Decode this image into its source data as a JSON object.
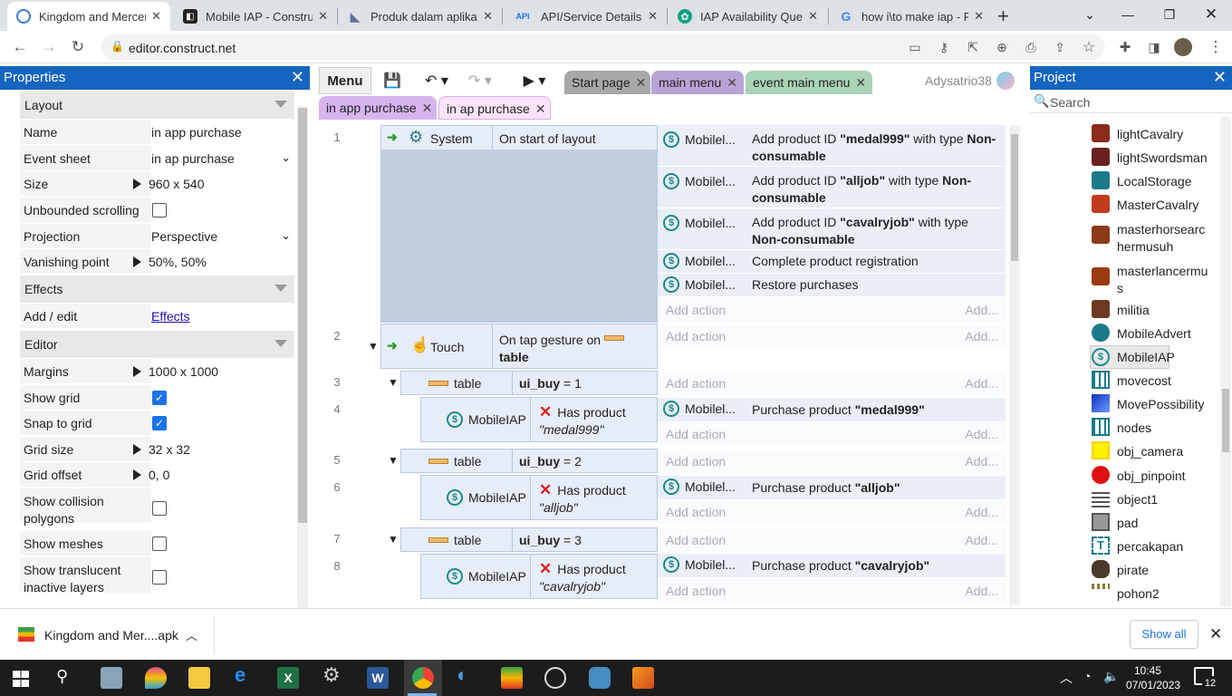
{
  "browser": {
    "tabs": [
      {
        "label": "Kingdom and Mercen",
        "active": true
      },
      {
        "label": "Mobile IAP - Construc"
      },
      {
        "label": "Produk dalam aplikasi"
      },
      {
        "label": "API/Service Details – A"
      },
      {
        "label": "IAP Availability Query"
      },
      {
        "label": "how i\\to make iap - Pe"
      }
    ],
    "new_tab": "+",
    "url": "editor.construct.net"
  },
  "properties": {
    "title": "Properties",
    "sections": {
      "layout": "Layout",
      "effects": "Effects",
      "editor": "Editor"
    },
    "rows": {
      "name": {
        "label": "Name",
        "value": "in app purchase"
      },
      "event_sheet": {
        "label": "Event sheet",
        "value": "in ap purchase"
      },
      "size": {
        "label": "Size",
        "value": "960 x 540"
      },
      "unbounded": {
        "label": "Unbounded scrolling"
      },
      "projection": {
        "label": "Projection",
        "value": "Perspective"
      },
      "vanishing": {
        "label": "Vanishing point",
        "value": "50%, 50%"
      },
      "add_edit": {
        "label": "Add / edit",
        "value": "Effects"
      },
      "margins": {
        "label": "Margins",
        "value": "1000 x 1000"
      },
      "show_grid": {
        "label": "Show grid"
      },
      "snap_grid": {
        "label": "Snap to grid"
      },
      "grid_size": {
        "label": "Grid size",
        "value": "32 x 32"
      },
      "grid_offset": {
        "label": "Grid offset",
        "value": "0, 0"
      },
      "collision_1": {
        "label": "Show collision"
      },
      "collision_2": {
        "label": "polygons"
      },
      "meshes": {
        "label": "Show meshes"
      },
      "translucent_1": {
        "label": "Show translucent"
      },
      "translucent_2": {
        "label": "inactive layers"
      }
    }
  },
  "toolbar": {
    "menu": "Menu",
    "tabs_top": [
      "Start page",
      "main menu",
      "event main menu"
    ],
    "tabs_bottom": [
      "in app purchase",
      "in ap purchase"
    ],
    "user": "Adysatrio38"
  },
  "events": {
    "e1": {
      "num": "1",
      "obj": "System",
      "cond": "On start of layout"
    },
    "e1_actions": [
      {
        "obj": "Mobilel...",
        "pre": "Add product ID ",
        "id": "\"medal999\"",
        "mid": " with type ",
        "post": "Non-consumable"
      },
      {
        "obj": "Mobilel...",
        "pre": "Add product ID ",
        "id": "\"alljob\"",
        "mid": " with type ",
        "post": "Non-consumable"
      },
      {
        "obj": "Mobilel...",
        "pre": "Add product ID ",
        "id": "\"cavalryjob\"",
        "mid": " with type ",
        "post": "Non-consumable"
      },
      {
        "obj": "Mobilel...",
        "text": "Complete product registration"
      },
      {
        "obj": "Mobilel...",
        "text": "Restore purchases"
      }
    ],
    "add_action": "Add action",
    "add_more": "Add...",
    "e2": {
      "num": "2",
      "obj": "Touch",
      "cond_a": "On tap gesture on",
      "cond_b": "table"
    },
    "e3": {
      "num": "3",
      "obj": "table",
      "var": "ui_buy",
      "op": "= 1"
    },
    "e4": {
      "num": "4",
      "obj": "MobileIAP",
      "cond": "Has product",
      "arg": "\"medal999\"",
      "act_obj": "Mobilel...",
      "act_pre": "Purchase product ",
      "act_arg": "\"medal999\""
    },
    "e5": {
      "num": "5",
      "obj": "table",
      "var": "ui_buy",
      "op": "= 2"
    },
    "e6": {
      "num": "6",
      "obj": "MobileIAP",
      "cond": "Has product",
      "arg": "\"alljob\"",
      "act_obj": "Mobilel...",
      "act_pre": "Purchase product ",
      "act_arg": "\"alljob\""
    },
    "e7": {
      "num": "7",
      "obj": "table",
      "var": "ui_buy",
      "op": "= 3"
    },
    "e8": {
      "num": "8",
      "obj": "MobileIAP",
      "cond": "Has product",
      "arg": "\"cavalryjob\"",
      "act_obj": "Mobilel...",
      "act_pre": "Purchase product ",
      "act_arg": "\"cavalryjob\""
    }
  },
  "project": {
    "title": "Project",
    "search_placeholder": "Search",
    "items": [
      {
        "label": "lightCavalry"
      },
      {
        "label": "lightSwordsman"
      },
      {
        "label": "LocalStorage"
      },
      {
        "label": "MasterCavalry"
      },
      {
        "label": "masterhorsearc",
        "label2": "hermusuh"
      },
      {
        "label": "masterlancermu",
        "label2": "s"
      },
      {
        "label": "militia"
      },
      {
        "label": "MobileAdvert"
      },
      {
        "label": "MobileIAP"
      },
      {
        "label": "movecost"
      },
      {
        "label": "MovePossibility"
      },
      {
        "label": "nodes"
      },
      {
        "label": "obj_camera"
      },
      {
        "label": "obj_pinpoint"
      },
      {
        "label": "object1"
      },
      {
        "label": "pad"
      },
      {
        "label": "percakapan"
      },
      {
        "label": "pirate"
      },
      {
        "label": "pohon2"
      }
    ]
  },
  "downloads": {
    "file": "Kingdom and Mer....apk",
    "show_all": "Show all"
  },
  "taskbar": {
    "time": "10:45",
    "date": "07/01/2023",
    "notifications": "12"
  }
}
